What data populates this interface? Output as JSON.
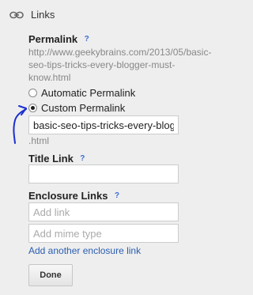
{
  "header": {
    "title": "Links",
    "icon": "link-icon"
  },
  "permalink": {
    "label": "Permalink",
    "help": "?",
    "url": "http://www.geekybrains.com/2013/05/basic-seo-tips-tricks-every-blogger-must-know.html",
    "options": {
      "automatic": "Automatic Permalink",
      "custom": "Custom Permalink"
    },
    "selected": "custom",
    "custom_value": "basic-seo-tips-tricks-every-blog",
    "suffix": ".html"
  },
  "title_link": {
    "label": "Title Link",
    "help": "?",
    "value": ""
  },
  "enclosure": {
    "label": "Enclosure Links",
    "help": "?",
    "link_placeholder": "Add link",
    "mime_placeholder": "Add mime type",
    "add_another": "Add another enclosure link"
  },
  "done_label": "Done",
  "colors": {
    "background": "#eeeeee",
    "link": "#2a5db0",
    "help": "#3b6dd6",
    "annotation_ink": "#1a2fd0"
  }
}
